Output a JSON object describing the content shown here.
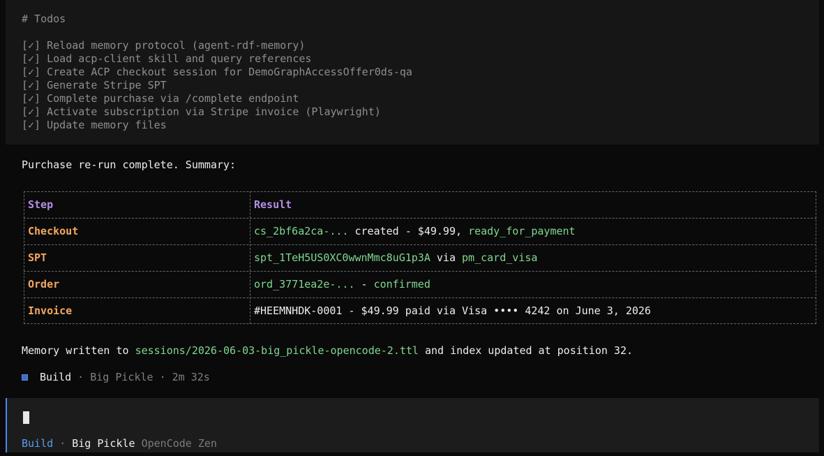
{
  "todos": {
    "heading": "# Todos",
    "items": [
      "[✓] Reload memory protocol (agent-rdf-memory)",
      "[✓] Load acp-client skill and query references",
      "[✓] Create ACP checkout session for DemoGraphAccessOffer0ds-qa",
      "[✓] Generate Stripe SPT",
      "[✓] Complete purchase via /complete endpoint",
      "[✓] Activate subscription via Stripe invoice (Playwright)",
      "[✓] Update memory files"
    ]
  },
  "summary_intro": "Purchase re-run complete. Summary:",
  "table": {
    "headers": [
      "Step",
      "Result"
    ],
    "rows": [
      {
        "step": "Checkout",
        "parts": [
          "cs_2bf6a2ca-...",
          " created - $49.99, ",
          "ready_for_payment",
          "",
          ""
        ]
      },
      {
        "step": "SPT",
        "parts": [
          "spt_1TeH5US0XC0wwnMmc8uG1p3A",
          " via ",
          "pm_card_visa",
          "",
          ""
        ]
      },
      {
        "step": "Order",
        "parts": [
          "ord_3771ea2e-...",
          " - ",
          "confirmed",
          "",
          ""
        ]
      },
      {
        "step": "Invoice",
        "parts": [
          "",
          "#HEEMNHDK-0001 - $49.99 paid via Visa •••• 4242 on June 3, 2026",
          "",
          "",
          ""
        ]
      }
    ]
  },
  "memory": {
    "prefix": "Memory written to ",
    "path": "sessions/2026-06-03-big_pickle-opencode-2.ttl",
    "suffix": " and index updated at position 32."
  },
  "status": {
    "mode": "Build",
    "sep1": " · ",
    "model": "Big Pickle",
    "sep2": " · ",
    "duration": "2m 32s"
  },
  "prompt": {
    "mode": "Build",
    "sep": " · ",
    "model": "Big Pickle",
    "provider": "OpenCode Zen"
  },
  "colors": {
    "accent_blue": "#5a9cf0",
    "green": "#7fd88f",
    "orange": "#f5a860",
    "purple": "#b48ee8"
  }
}
